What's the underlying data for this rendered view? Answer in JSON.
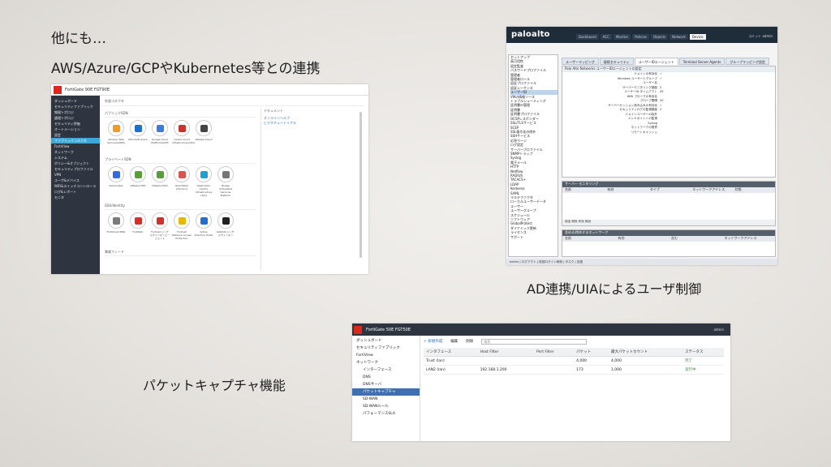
{
  "slide": {
    "intro": "他にも…",
    "cloud_text": "AWS/Azure/GCPやKubernetes等との連携",
    "ad_caption": "AD連携/UIAによるユーザ制御",
    "pcap_caption": "パケットキャプチャ機能"
  },
  "shot1": {
    "brand": "FortiGate 90E   FGT90E",
    "header": "外部コネクタ",
    "sidebar": [
      "ダッシュボード",
      "セキュリティファブリック",
      "物理トポロジ",
      "論理トポロジ",
      "セキュリティ評価",
      "オートメーション",
      "設定",
      "ファブリックコネクタ",
      "FortiView",
      "ネットワーク",
      "システム",
      "ポリシー&オブジェクト",
      "セキュリティプロファイル",
      "VPN",
      "ユーザ&デバイス",
      "WiFi&スイッチコントローラ",
      "ログ&レポート",
      "モニタ"
    ],
    "group_public": "パブリックSDN",
    "group_private": "プライベートSDN",
    "group_sso": "SSO/Identity",
    "group_threat": "脅威フィード",
    "public_cards": [
      {
        "label": "Amazon Web Services(AWS)",
        "color": "#f29b1d"
      },
      {
        "label": "Microsoft Azure",
        "color": "#1f6fd1"
      },
      {
        "label": "Google Cloud Platform(GCP)",
        "color": "#3b7ddd"
      },
      {
        "label": "Oracle Cloud Infrastructure(OCI)",
        "color": "#d0312d"
      },
      {
        "label": "Alibaba Cloud",
        "color": "#444444"
      }
    ],
    "private_cards": [
      {
        "label": "Kubernetes",
        "color": "#326ce5"
      },
      {
        "label": "VMware NSX",
        "color": "#5a9e3a"
      },
      {
        "label": "VMware ESXi",
        "color": "#5a9e3a"
      },
      {
        "label": "OpenStack (Horizon)",
        "color": "#d9534f"
      },
      {
        "label": "Application Centric Infrastructure (ACI)",
        "color": "#1ba0d7"
      },
      {
        "label": "Nuage Virtualized Services Platform",
        "color": "#777777"
      }
    ],
    "sso_cards": [
      {
        "label": "FortiClient EMS",
        "color": "#7a7a7a"
      },
      {
        "label": "FortiNAC",
        "color": "#d0312d"
      },
      {
        "label": "Fortinet シングルサインオンエージェント",
        "color": "#d0312d"
      },
      {
        "label": "Fortinet Network Access Protection",
        "color": "#e6b800"
      },
      {
        "label": "Active Directory Poller",
        "color": "#1f6fd1"
      },
      {
        "label": "RADIUS シングルサインオン",
        "color": "#222222"
      }
    ],
    "right_header": "ドキュメント",
    "right_links": [
      "オンラインヘルプ",
      "ビデオチュートリアル"
    ]
  },
  "shot2": {
    "logo": "paloalto",
    "tabs": [
      "Dashboard",
      "ACC",
      "Monitor",
      "Policies",
      "Objects",
      "Network",
      "Device"
    ],
    "right": "コミット  admin",
    "tree": [
      "セットアップ",
      "高可用性",
      "設定監査",
      "パスワードプロファイル",
      "管理者",
      "管理者ロール",
      "認証プロファイル",
      "認証シーケンス",
      "ユーザーID",
      "VMの情報ソース",
      "トラブルシューティング",
      "証明書の管理",
      "証明書",
      "証明書プロファイル",
      "OCSPレスポンダー",
      "SSL/TLSサービス",
      "SCEP",
      "SSL復号化の除外",
      "SSHサービス",
      "応答ページ",
      "ログ設定",
      "サーバープロファイル",
      "SNMPトラップ",
      "Syslog",
      "電子メール",
      "HTTP",
      "Netflow",
      "RADIUS",
      "TACACS+",
      "LDAP",
      "Kerberos",
      "SAML",
      "マルチファクタ",
      "ローカルユーザーデータ",
      "ユーザー",
      "ユーザーグループ",
      "スケジュール",
      "ソフトウェア",
      "GlobalProtect",
      "ダイナミック更新",
      "ライセンス",
      "サポート"
    ],
    "user_tabs": [
      "ユーザーマッピング",
      "接続セキュリティ",
      "ユーザーIDエージェント",
      "Terminal Server Agents",
      "グループマッピング設定"
    ],
    "panel_header": "Palo Alto Networks ユーザーIDエージェントの設定",
    "settings": [
      {
        "k": "ドメインの有効化",
        "v": "✓"
      },
      {
        "k": "Windows ユーザーとグループ",
        "v": "✓"
      },
      {
        "k": "ユーザー名",
        "v": ""
      },
      {
        "k": "サーバーモニタリング頻度",
        "v": "2"
      },
      {
        "k": "ユーザーID タイムアウト",
        "v": "45"
      },
      {
        "k": "WMI プローブの有効化",
        "v": ""
      },
      {
        "k": "プローブ間隔",
        "v": "20"
      },
      {
        "k": "サーバーセッション読み込みの有効化",
        "v": "✓"
      },
      {
        "k": "セキュリティログの監視頻度",
        "v": "2"
      },
      {
        "k": "ドメインユーザーの除外",
        "v": ""
      },
      {
        "k": "エンドポイントの監視",
        "v": ""
      },
      {
        "k": "Syslog",
        "v": ""
      },
      {
        "k": "ネットワークの限界",
        "v": ""
      },
      {
        "k": "リモートキャッシュ",
        "v": ""
      }
    ],
    "sec1_header": "サーバー モニタリング",
    "sec1_cols": [
      "名前",
      "有効",
      "タイプ",
      "ネットワークアドレス",
      "状態"
    ],
    "sec1_foot": "追加  削除  有効  無効",
    "sec2_header": "含める/除外するネットワーク",
    "sec2_cols": [
      "名前",
      "有効",
      "含む",
      "ネットワークアドレス"
    ],
    "bottom": "admin | ログアウト | 前回ログイン時刻 | タスク | 言語"
  },
  "shot3": {
    "brand": "FortiGate 50E   FGT50E",
    "user": "admin",
    "sidebar": [
      {
        "label": "ダッシュボード",
        "sub": false,
        "sel": false
      },
      {
        "label": "セキュリティファブリック",
        "sub": false,
        "sel": false
      },
      {
        "label": "FortiView",
        "sub": false,
        "sel": false
      },
      {
        "label": "ネットワーク",
        "sub": false,
        "sel": false
      },
      {
        "label": "インターフェース",
        "sub": true,
        "sel": false
      },
      {
        "label": "DNS",
        "sub": true,
        "sel": false
      },
      {
        "label": "DNSサーバ",
        "sub": true,
        "sel": false
      },
      {
        "label": "パケットキャプチャ",
        "sub": true,
        "sel": true
      },
      {
        "label": "SD-WAN",
        "sub": true,
        "sel": false
      },
      {
        "label": "SD-WANルール",
        "sub": true,
        "sel": false
      },
      {
        "label": "パフォーマンスSLA",
        "sub": true,
        "sel": false
      }
    ],
    "toolbar": [
      "+ 新規作成",
      "編集",
      "削除"
    ],
    "search_placeholder": "検索",
    "columns": [
      "インタフェース",
      "Host Filter",
      "Port Filter",
      "パケット",
      "最大パケットカウント",
      "ステータス"
    ],
    "rows": [
      {
        "iface": "Trust (lan)",
        "host": "",
        "port": "",
        "packets": "4,000",
        "max": "4,000",
        "status": "完了"
      },
      {
        "iface": "LAN2 (lan)",
        "host": "192.168.1.200",
        "port": "",
        "packets": "173",
        "max": "1,000",
        "status": "実行中"
      }
    ]
  }
}
